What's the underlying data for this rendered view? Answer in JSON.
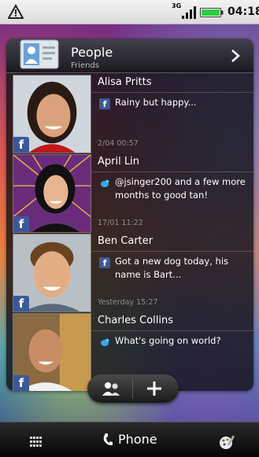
{
  "status_bar": {
    "network": "3G",
    "time": "04:18"
  },
  "widget": {
    "title": "People",
    "subtitle": "Friends",
    "contacts": [
      {
        "name": "Alisa Pritts",
        "source_icon": "facebook-icon",
        "status": "Rainy but happy...",
        "time": "2/04 00:57"
      },
      {
        "name": "April Lin",
        "source_icon": "twitter-bird-icon",
        "status": "@jsinger200 and a few more months to good tan!",
        "time": "17/01 11:22"
      },
      {
        "name": "Ben Carter",
        "source_icon": "facebook-icon",
        "status": "Got a new dog today, his name is Bart...",
        "time": "Yesterday 15:27"
      },
      {
        "name": "Charles Collins",
        "source_icon": "twitter-bird-icon",
        "status": "What's going on world?",
        "time": ""
      }
    ]
  },
  "dock": {
    "phone_label": "Phone"
  },
  "icons": {
    "status_warning": "warning-icon",
    "signal": "signal-icon",
    "battery": "battery-icon",
    "widget_app": "contact-book-icon",
    "expand": "chevron-right-icon",
    "action_people": "people-icon",
    "action_add": "plus-icon",
    "dock_apps": "all-apps-icon",
    "dock_phone": "phone-icon",
    "dock_personalize": "personalize-icon"
  },
  "colors": {
    "facebook": "#3b5998",
    "twitter": "#33aaee",
    "battery": "#2ecc40"
  }
}
